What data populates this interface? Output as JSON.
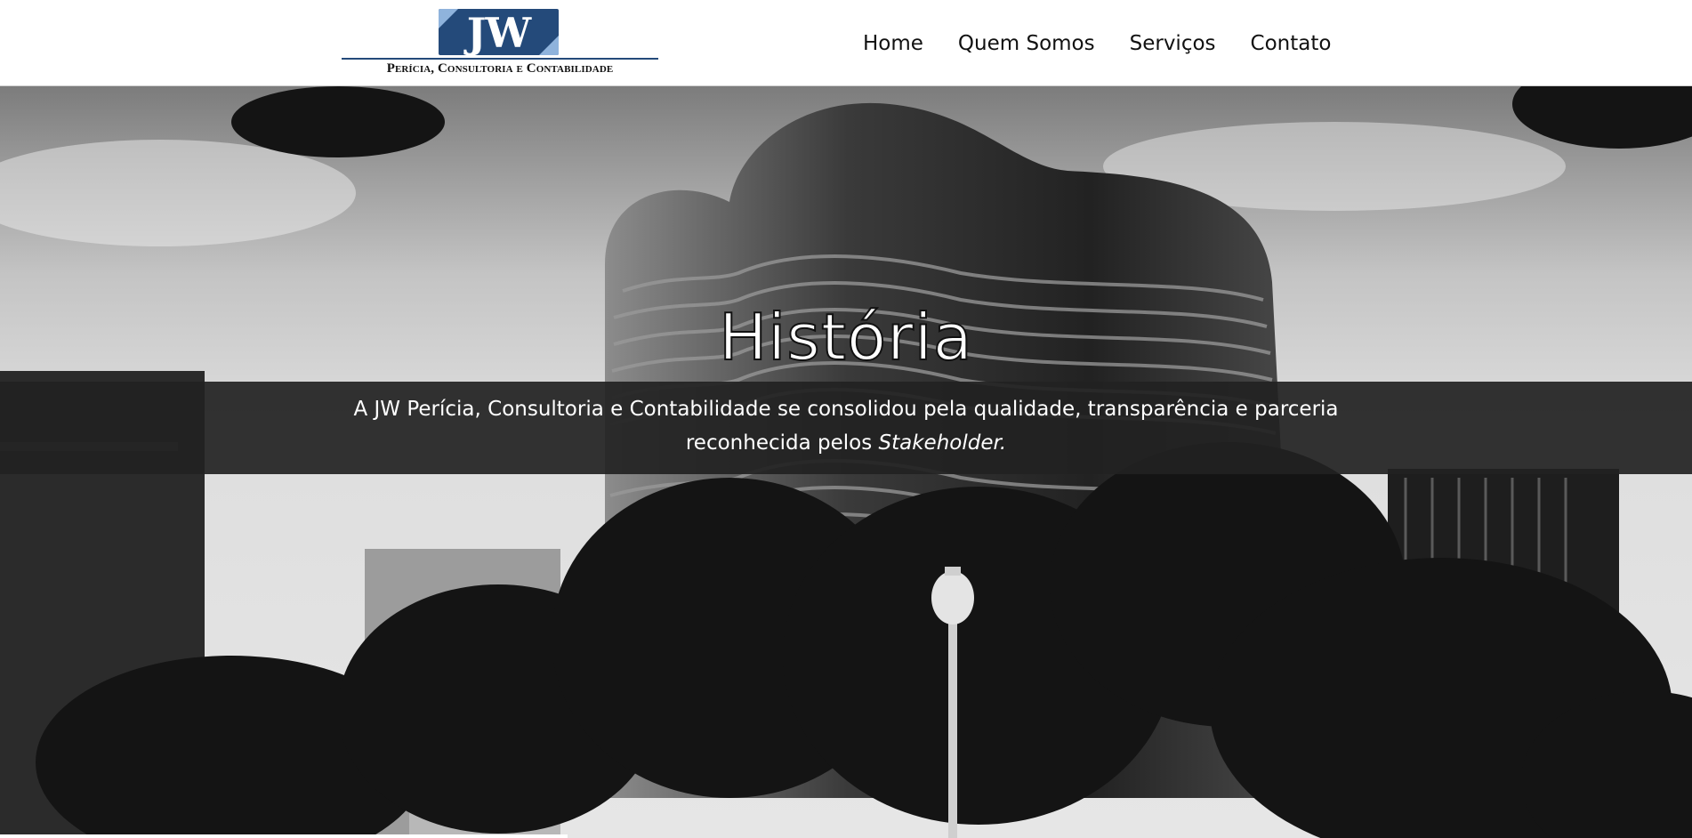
{
  "brand": {
    "logo_mark": "JW",
    "logo_subtitle": "Perícia, Consultoria e Contabilidade",
    "colors": {
      "navy": "#244a7a",
      "light_blue": "#8fb3dc"
    }
  },
  "nav": {
    "items": [
      {
        "label": "Home"
      },
      {
        "label": "Quem Somos"
      },
      {
        "label": "Serviços"
      },
      {
        "label": "Contato"
      }
    ]
  },
  "hero": {
    "title": "História",
    "text": "A JW Perícia, Consultoria e Contabilidade se consolidou pela qualidade, transparência e parceria reconhecida pelos",
    "text_emphasis": "Stakeholder.",
    "background": "black-and-white photo of curved residential tower, trees and street lamp"
  }
}
